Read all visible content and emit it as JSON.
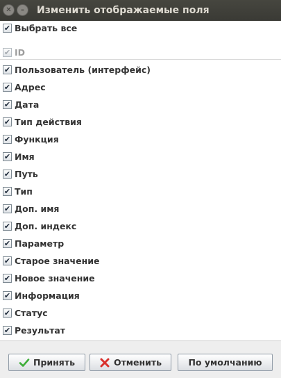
{
  "window": {
    "title": "Изменить отображаемые поля"
  },
  "select_all": {
    "label": "Выбрать все",
    "checked": true
  },
  "fields": [
    {
      "label": "ID",
      "checked": true,
      "disabled": true
    },
    {
      "label": "Пользователь (интерфейс)",
      "checked": true,
      "disabled": false
    },
    {
      "label": "Адрес",
      "checked": true,
      "disabled": false
    },
    {
      "label": "Дата",
      "checked": true,
      "disabled": false
    },
    {
      "label": "Тип действия",
      "checked": true,
      "disabled": false
    },
    {
      "label": "Функция",
      "checked": true,
      "disabled": false
    },
    {
      "label": "Имя",
      "checked": true,
      "disabled": false
    },
    {
      "label": "Путь",
      "checked": true,
      "disabled": false
    },
    {
      "label": "Тип",
      "checked": true,
      "disabled": false
    },
    {
      "label": "Доп. имя",
      "checked": true,
      "disabled": false
    },
    {
      "label": "Доп. индекс",
      "checked": true,
      "disabled": false
    },
    {
      "label": "Параметр",
      "checked": true,
      "disabled": false
    },
    {
      "label": "Старое значение",
      "checked": true,
      "disabled": false
    },
    {
      "label": "Новое значение",
      "checked": true,
      "disabled": false
    },
    {
      "label": "Информация",
      "checked": true,
      "disabled": false
    },
    {
      "label": "Статус",
      "checked": true,
      "disabled": false
    },
    {
      "label": "Результат",
      "checked": true,
      "disabled": false
    }
  ],
  "buttons": {
    "ok_label": "Принять",
    "ok_icon": "checkmark-icon",
    "cancel_label": "Отменить",
    "cancel_icon": "red-x-icon",
    "default_label": "По умолчанию"
  },
  "colors": {
    "titlebar": "#3f3f3a",
    "ok_icon": "#3fae3a",
    "cancel_icon": "#d9302c"
  }
}
